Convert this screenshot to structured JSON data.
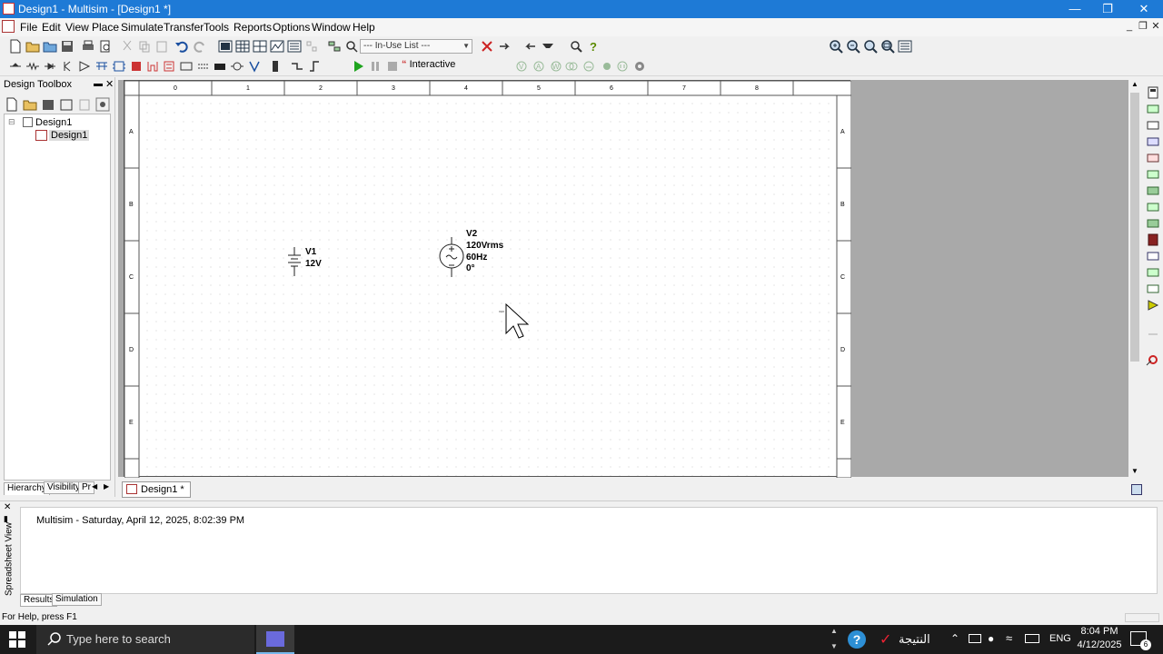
{
  "window": {
    "title": "Design1 - Multisim - [Design1 *]"
  },
  "menu": [
    "File",
    "Edit",
    "View",
    "Place",
    "Simulate",
    "Transfer",
    "Tools",
    "Reports",
    "Options",
    "Window",
    "Help"
  ],
  "toolbar": {
    "in_use_list": "--- In-Use List ---",
    "interactive_label": "Interactive"
  },
  "toolbox": {
    "title": "Design Toolbox",
    "tree_root": "Design1",
    "tree_child": "Design1",
    "tabs": [
      "Hierarchy",
      "Visibility",
      "Pr"
    ]
  },
  "sheet": {
    "col_labels": [
      "0",
      "1",
      "2",
      "3",
      "4",
      "5",
      "6",
      "7",
      "8"
    ],
    "row_labels": [
      "A",
      "B",
      "C",
      "D",
      "E"
    ],
    "components": {
      "v1": {
        "ref": "V1",
        "value": "12V"
      },
      "v2": {
        "ref": "V2",
        "voltage": "120Vrms",
        "freq": "60Hz",
        "phase": "0°"
      }
    },
    "tab_label": "Design1 *"
  },
  "spreadsheet": {
    "side_label": "Spreadsheet View",
    "log_line": "Multisim  -  Saturday, April 12, 2025, 8:02:39 PM",
    "tabs": [
      "Results",
      "Simulation"
    ]
  },
  "status": {
    "help_text": "For Help, press F1"
  },
  "taskbar": {
    "search_placeholder": "Type here to search",
    "arabic_label": "النتيجة",
    "lang": "ENG",
    "time": "8:04 PM",
    "date": "4/12/2025",
    "notification_count": "6"
  }
}
